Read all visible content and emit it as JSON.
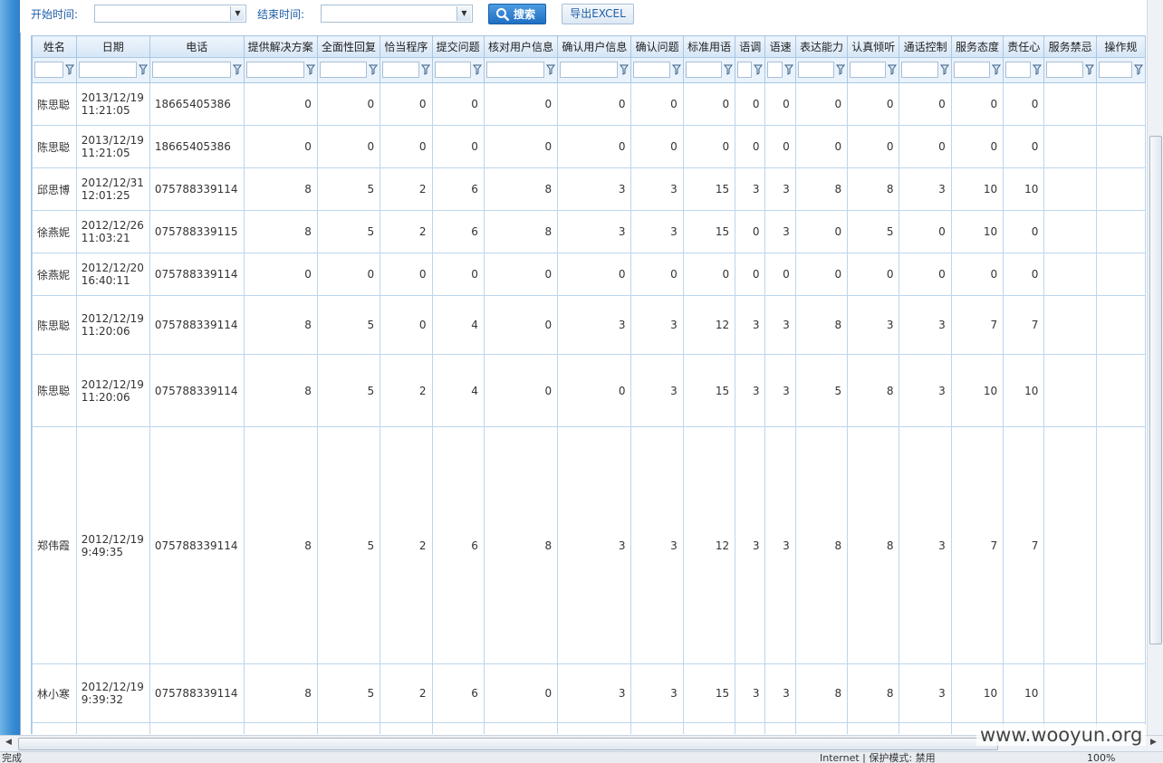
{
  "toolbar": {
    "start_label": "开始时间:",
    "start_value": "",
    "end_label": "结束时间:",
    "end_value": "",
    "search_label": "搜索",
    "export_label": "导出EXCEL",
    "search_icon": "magnifier-icon"
  },
  "columns": [
    "姓名",
    "日期",
    "电话",
    "提供解决方案",
    "全面性回复",
    "恰当程序",
    "提交问题",
    "核对用户信息",
    "确认用户信息",
    "确认问题",
    "标准用语",
    "语调",
    "语速",
    "表达能力",
    "认真倾听",
    "通话控制",
    "服务态度",
    "责任心",
    "服务禁忌",
    "操作规"
  ],
  "rows": [
    {
      "name": "陈思聪",
      "date": "2013/12/19",
      "time": "11:21:05",
      "phone": "18665405386",
      "v": [
        "0",
        "0",
        "0",
        "0",
        "0",
        "0",
        "0",
        "0",
        "0",
        "0",
        "0",
        "0",
        "0",
        "0",
        "0"
      ]
    },
    {
      "name": "陈思聪",
      "date": "2013/12/19",
      "time": "11:21:05",
      "phone": "18665405386",
      "v": [
        "0",
        "0",
        "0",
        "0",
        "0",
        "0",
        "0",
        "0",
        "0",
        "0",
        "0",
        "0",
        "0",
        "0",
        "0"
      ]
    },
    {
      "name": "邱思博",
      "date": "2012/12/31",
      "time": "12:01:25",
      "phone": "075788339114",
      "v": [
        "8",
        "5",
        "2",
        "6",
        "8",
        "3",
        "3",
        "15",
        "3",
        "3",
        "8",
        "8",
        "3",
        "10",
        "10"
      ]
    },
    {
      "name": "徐燕妮",
      "date": "2012/12/26",
      "time": "11:03:21",
      "phone": "075788339115",
      "v": [
        "8",
        "5",
        "2",
        "6",
        "8",
        "3",
        "3",
        "15",
        "0",
        "3",
        "0",
        "5",
        "0",
        "10",
        "0"
      ]
    },
    {
      "name": "徐燕妮",
      "date": "2012/12/20",
      "time": "16:40:11",
      "phone": "075788339114",
      "v": [
        "0",
        "0",
        "0",
        "0",
        "0",
        "0",
        "0",
        "0",
        "0",
        "0",
        "0",
        "0",
        "0",
        "0",
        "0"
      ]
    },
    {
      "name": "陈思聪",
      "date": "2012/12/19",
      "time": "11:20:06",
      "phone": "075788339114",
      "v": [
        "8",
        "5",
        "0",
        "4",
        "0",
        "3",
        "3",
        "12",
        "3",
        "3",
        "8",
        "3",
        "3",
        "7",
        "7"
      ]
    },
    {
      "name": "陈思聪",
      "date": "2012/12/19",
      "time": "11:20:06",
      "phone": "075788339114",
      "v": [
        "8",
        "5",
        "2",
        "4",
        "0",
        "0",
        "3",
        "15",
        "3",
        "3",
        "5",
        "8",
        "3",
        "10",
        "10"
      ]
    },
    {
      "name": "郑伟霞",
      "date": "2012/12/19",
      "time": "9:49:35",
      "phone": "075788339114",
      "v": [
        "8",
        "5",
        "2",
        "6",
        "8",
        "3",
        "3",
        "12",
        "3",
        "3",
        "8",
        "8",
        "3",
        "7",
        "7"
      ]
    },
    {
      "name": "林小寒",
      "date": "2012/12/19",
      "time": "9:39:32",
      "phone": "075788339114",
      "v": [
        "8",
        "5",
        "2",
        "6",
        "0",
        "3",
        "3",
        "15",
        "3",
        "3",
        "8",
        "8",
        "3",
        "10",
        "10"
      ]
    }
  ],
  "watermark": "www.wooyun.org",
  "status": {
    "left": "完成",
    "zone": "Internet | 保护模式: 禁用",
    "zoom": "100%"
  }
}
